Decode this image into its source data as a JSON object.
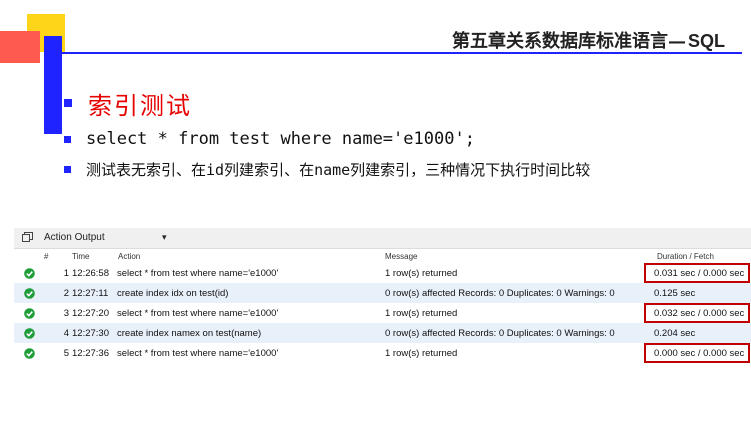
{
  "slide": {
    "chapter_title": "第五章关系数据库标准语言—",
    "chapter_sql": "SQL",
    "heading": "索引测试",
    "bullet_sql": "select * from test where name='e1000';",
    "bullet_desc": "测试表无索引、在id列建索引、在name列建索引，三种情况下执行时间比较"
  },
  "output_panel": {
    "title": "Action Output",
    "dropdown_icon": "caret-down-icon",
    "columns": {
      "index": "#",
      "time": "Time",
      "action": "Action",
      "message": "Message",
      "duration": "Duration / Fetch"
    },
    "rows": [
      {
        "index": "1",
        "time": "12:26:58",
        "action": "select * from test where name='e1000'",
        "message": "1 row(s) returned",
        "duration": "0.031 sec / 0.000 sec",
        "status": "success",
        "highlighted": true
      },
      {
        "index": "2",
        "time": "12:27:11",
        "action": "create index idx on test(id)",
        "message": "0 row(s) affected Records: 0  Duplicates: 0  Warnings: 0",
        "duration": "0.125 sec",
        "status": "success",
        "highlighted": false
      },
      {
        "index": "3",
        "time": "12:27:20",
        "action": "select * from test where name='e1000'",
        "message": "1 row(s) returned",
        "duration": "0.032 sec / 0.000 sec",
        "status": "success",
        "highlighted": true
      },
      {
        "index": "4",
        "time": "12:27:30",
        "action": "create index namex on test(name)",
        "message": "0 row(s) affected Records: 0  Duplicates: 0  Warnings: 0",
        "duration": "0.204 sec",
        "status": "success",
        "highlighted": false
      },
      {
        "index": "5",
        "time": "12:27:36",
        "action": "select * from test where name='e1000'",
        "message": "1 row(s) returned",
        "duration": "0.000 sec / 0.000 sec",
        "status": "success",
        "highlighted": true
      }
    ]
  },
  "colors": {
    "accent_blue": "#1f23ff",
    "heading_red": "#e60000",
    "success_green": "#1e9e3a",
    "highlight_red": "#c00000"
  }
}
